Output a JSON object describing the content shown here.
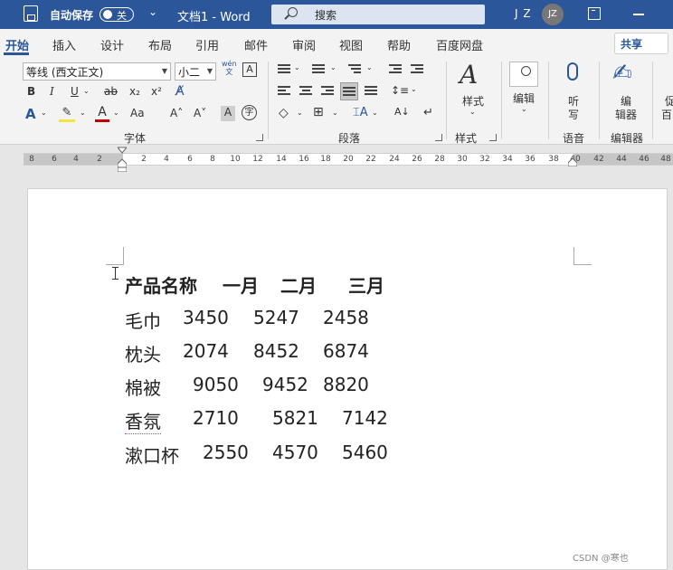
{
  "titlebar": {
    "autosave_label": "自动保存",
    "autosave_state": "关",
    "doc_title": "文档1  -  Word",
    "search_placeholder": "搜索",
    "user_initials": "J Z",
    "avatar_text": "JZ",
    "bg_color": "#2b579a"
  },
  "tabs": [
    "开始",
    "插入",
    "设计",
    "布局",
    "引用",
    "邮件",
    "审阅",
    "视图",
    "帮助",
    "百度网盘"
  ],
  "share_label": "共享",
  "ribbon": {
    "font_name": "等线 (西文正文)",
    "font_size": "小二",
    "group_font": "字体",
    "group_paragraph": "段落",
    "group_styles": "样式",
    "group_voice": "语音",
    "group_editor": "编辑器",
    "styles_label": "样式",
    "editing_label": "编辑",
    "dictate_label_1": "听",
    "dictate_label_2": "写",
    "editor_label_1": "编",
    "editor_label_2": "辑器",
    "reuse_label_1": "促",
    "reuse_label_2": "百",
    "bold": "B",
    "italic": "I",
    "underline": "U",
    "strike": "ab",
    "subscript": "x₂",
    "superscript": "x²",
    "text_effect": "A",
    "highlight": "ab",
    "font_color": "A",
    "change_case": "Aa",
    "grow_font": "A^",
    "shrink_font": "Aˇ",
    "char_shading": "A",
    "enclose": "字",
    "wen_label": "wén\n文"
  },
  "ruler": {
    "ticks": [
      "8",
      "6",
      "4",
      "2",
      "2",
      "4",
      "6",
      "8",
      "10",
      "12",
      "14",
      "16",
      "18",
      "20",
      "22",
      "24",
      "26",
      "28",
      "30",
      "32",
      "34",
      "36",
      "38",
      "40",
      "42",
      "44",
      "46",
      "48"
    ]
  },
  "document": {
    "header": [
      "产品名称",
      "一月",
      "二月",
      "三月"
    ],
    "rows": [
      [
        "毛巾",
        "3450",
        "5247",
        "2458"
      ],
      [
        "枕头",
        "2074",
        "8452",
        "6874"
      ],
      [
        "棉被",
        "9050",
        "9452",
        "8820"
      ],
      [
        "香氛",
        "2710",
        "5821",
        "7142"
      ],
      [
        "漱口杯",
        "2550",
        "4570",
        "5460"
      ]
    ]
  },
  "watermark": "CSDN @寒也"
}
